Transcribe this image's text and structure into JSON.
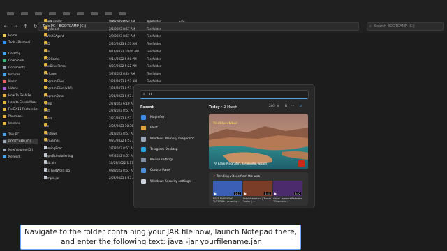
{
  "explorer": {
    "breadcrumb": "This PC  ›  BOOTCAMP (C:)",
    "search_placeholder": "Search BOOTCAMP (C:)",
    "columns": {
      "name": "Name",
      "date": "Date modified",
      "type": "Type",
      "size": "Size"
    },
    "sidebar": [
      {
        "label": "Home"
      },
      {
        "label": "Tech - Personal"
      },
      {
        "label": "Desktop"
      },
      {
        "label": "Downloads"
      },
      {
        "label": "Documents"
      },
      {
        "label": "Pictures"
      },
      {
        "label": "Music"
      },
      {
        "label": "Videos"
      },
      {
        "label": "How To Fix A Pe"
      },
      {
        "label": "How to Check Moo"
      },
      {
        "label": "Fix DX11 Feature Le"
      },
      {
        "label": "Pharmacs"
      },
      {
        "label": "Immons"
      },
      {
        "label": "This PC"
      },
      {
        "label": "BOOTCAMP (C:)"
      },
      {
        "label": "New Volume (D:)"
      },
      {
        "label": "Network"
      }
    ],
    "files": [
      {
        "name": "$GetCurrent",
        "date": "2/1/2023 8:57 AM",
        "type": "File folder"
      },
      {
        "name": "$SysReset",
        "date": "2/1/2023 8:57 AM",
        "type": "File folder"
      },
      {
        "name": "$WinREAgent",
        "date": "2/9/2023 8:57 AM",
        "type": "File folder"
      },
      {
        "name": "ESD",
        "date": "2/23/2023 8:57 AM",
        "type": "File folder"
      },
      {
        "name": "Intel",
        "date": "9/10/2022 10:06 AM",
        "type": "File folder"
      },
      {
        "name": "MSOCache",
        "date": "9/14/2022 5:50 PM",
        "type": "File folder"
      },
      {
        "name": "OneDriveTemp",
        "date": "8/21/2022 5:22 PM",
        "type": "File folder"
      },
      {
        "name": "PerfLogs",
        "date": "5/7/2022 6:24 AM",
        "type": "File folder"
      },
      {
        "name": "Program Files",
        "date": "2/28/2023 8:57 AM",
        "type": "File folder"
      },
      {
        "name": "Program Files (x86)",
        "date": "2/28/2023 8:57 AM",
        "type": "File folder"
      },
      {
        "name": "ProgramData",
        "date": "2/28/2023 8:57 AM",
        "type": "File folder"
      },
      {
        "name": "Temp",
        "date": "2/7/2023 6:10 AM",
        "type": "File folder"
      },
      {
        "name": "test",
        "date": "2/7/2023 8:57 AM",
        "type": "File folder"
      },
      {
        "name": "Users",
        "date": "2/23/2023 8:57 AM",
        "type": "File folder"
      },
      {
        "name": "win",
        "date": "2/25/2023 10:36 AM",
        "type": "File folder"
      },
      {
        "name": "Windows",
        "date": "3/1/2023 8:57 AM",
        "type": "File folder"
      },
      {
        "name": "WinGames",
        "date": "9/23/2022 8:57 AM",
        "type": "File folder"
      },
      {
        "name": "GamingRoot",
        "date": "2/7/2023 8:57 AM",
        "type": ""
      },
      {
        "name": "AppleBcInstaller.log",
        "date": "9/7/2022 8:57 AM",
        "type": ""
      },
      {
        "name": "indb.bin",
        "date": "10/28/2022 1:17 AM",
        "type": ""
      },
      {
        "name": "Ocs_FindWord.log",
        "date": "9/8/2022 8:57 AM",
        "type": ""
      },
      {
        "name": "sample.jar",
        "date": "2/25/2023 8:57 AM",
        "type": ""
      }
    ]
  },
  "start": {
    "query": "n",
    "recent_title": "Recent",
    "apps": [
      {
        "label": "Magnifier",
        "color": "#3b8eea"
      },
      {
        "label": "Paint",
        "color": "#e2a23a"
      },
      {
        "label": "Windows Memory Diagnostic",
        "color": "#9aa7b8"
      },
      {
        "label": "Telegram Desktop",
        "color": "#2aa3e2"
      },
      {
        "label": "Mouse settings",
        "color": "#7f8ea3"
      },
      {
        "label": "Control Panel",
        "color": "#4d90d9"
      },
      {
        "label": "Windows Security settings",
        "color": "#cfd6df"
      }
    ],
    "today_label": "Today",
    "today_date": "2 March",
    "points": "205",
    "avatar": "R",
    "hero": {
      "brand": "Teckkachhal",
      "caption": "Lake Negratin, Granada, Spain"
    },
    "trending": {
      "title": "Trending videos from the web",
      "videos": [
        {
          "caption": "BEST PARENTING TUTORIAL | Amazing ...",
          "duration": "2:13",
          "color": "#3b5fb5"
        },
        {
          "caption": "Fatal Attraction | Teaser Trailer | ...",
          "duration": "1:51",
          "color": "#7a3d28"
        },
        {
          "caption": "Adam Lambert Performs \"Chandelie...",
          "duration": "3:22",
          "color": "#4b2b6b"
        }
      ]
    }
  },
  "subtitle": "Navigate to the folder containing your JAR file now, launch Notepad there, and enter the following text: java -jar yourfilename.jar"
}
